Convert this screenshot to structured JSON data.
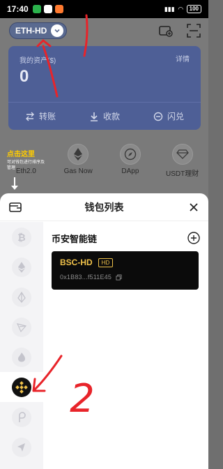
{
  "status_bar": {
    "time": "17:40",
    "signal": "4G",
    "battery": "100"
  },
  "header": {
    "wallet_chip_label": "ETH-HD"
  },
  "asset_card": {
    "title": "我的资产($)",
    "detail_link": "详情",
    "value": "0",
    "actions": [
      "转账",
      "收款",
      "闪兑"
    ]
  },
  "hint": {
    "title": "点击这里",
    "text": "可对钱包进行排序及管理"
  },
  "quick_links": [
    {
      "label": "Eth2.0",
      "icon": "eth2-icon"
    },
    {
      "label": "Gas Now",
      "icon": "ethereum-icon"
    },
    {
      "label": "DApp",
      "icon": "compass-icon"
    },
    {
      "label": "USDT理财",
      "icon": "diamond-icon"
    }
  ],
  "sheet": {
    "title": "钱包列表",
    "chains": [
      {
        "name": "bitcoin-icon",
        "active": false
      },
      {
        "name": "ethereum-icon",
        "active": false
      },
      {
        "name": "eos-icon",
        "active": false
      },
      {
        "name": "tron-icon",
        "active": false
      },
      {
        "name": "flame-icon",
        "active": false
      },
      {
        "name": "binance-icon",
        "active": true
      },
      {
        "name": "polkadot-icon",
        "active": false
      },
      {
        "name": "nav-arrow-icon",
        "active": false
      }
    ],
    "chain_name": "币安智能链",
    "wallet": {
      "name": "BSC-HD",
      "badge": "HD",
      "address": "0x1B83...f511E45"
    }
  },
  "annotations": {
    "label_2": "2"
  },
  "colors": {
    "accent_gold": "#f0c24a",
    "annotation_red": "#e8242a",
    "hint_yellow": "#ffcc00"
  }
}
